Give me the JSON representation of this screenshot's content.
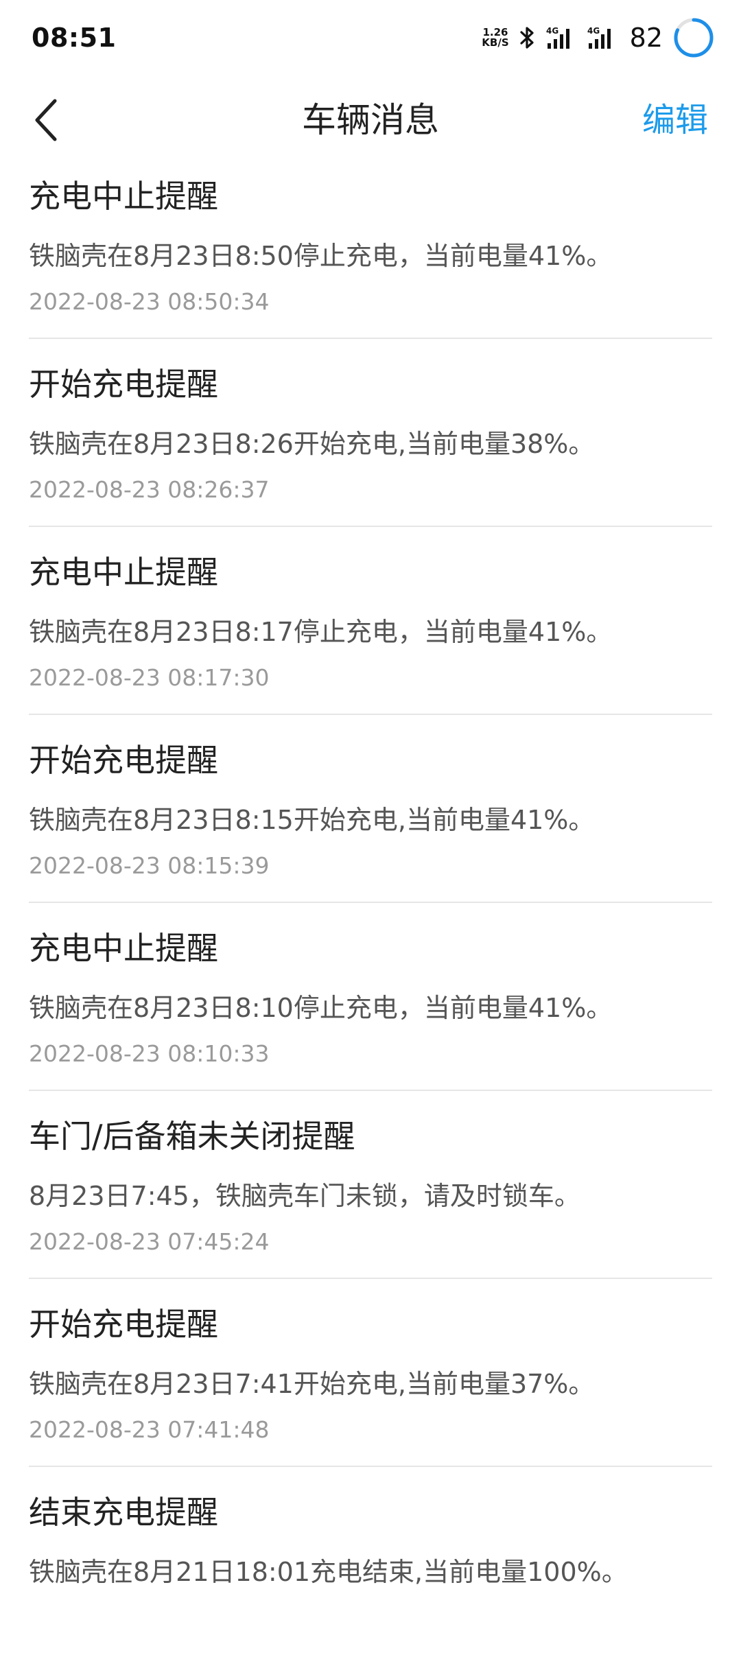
{
  "status_bar": {
    "time": "08:51",
    "net_speed_value": "1.26",
    "net_speed_unit": "KB/S",
    "signal_label_1": "4G",
    "signal_label_2": "4G",
    "battery": "82",
    "icons": [
      "bluetooth-icon",
      "signal-4g-icon",
      "signal-4g-icon",
      "battery-ring-icon"
    ],
    "battery_ring_color": "#1d8fe8"
  },
  "nav": {
    "title": "车辆消息",
    "edit_label": "编辑",
    "back_icon": "chevron-left-icon",
    "accent_color": "#1d9bea"
  },
  "messages": [
    {
      "title": "充电中止提醒",
      "content": "铁脑壳在8月23日8:50停止充电，当前电量41%。",
      "time": "2022-08-23 08:50:34"
    },
    {
      "title": "开始充电提醒",
      "content": "铁脑壳在8月23日8:26开始充电,当前电量38%。",
      "time": "2022-08-23 08:26:37"
    },
    {
      "title": "充电中止提醒",
      "content": "铁脑壳在8月23日8:17停止充电，当前电量41%。",
      "time": "2022-08-23 08:17:30"
    },
    {
      "title": "开始充电提醒",
      "content": "铁脑壳在8月23日8:15开始充电,当前电量41%。",
      "time": "2022-08-23 08:15:39"
    },
    {
      "title": "充电中止提醒",
      "content": "铁脑壳在8月23日8:10停止充电，当前电量41%。",
      "time": "2022-08-23 08:10:33"
    },
    {
      "title": "车门/后备箱未关闭提醒",
      "content": "8月23日7:45，铁脑壳车门未锁，请及时锁车。",
      "time": "2022-08-23 07:45:24"
    },
    {
      "title": "开始充电提醒",
      "content": "铁脑壳在8月23日7:41开始充电,当前电量37%。",
      "time": "2022-08-23 07:41:48"
    },
    {
      "title": "结束充电提醒",
      "content": "铁脑壳在8月21日18:01充电结束,当前电量100%。",
      "time": ""
    }
  ]
}
